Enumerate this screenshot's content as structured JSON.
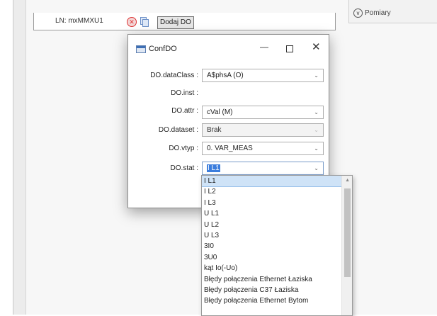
{
  "background": {
    "ln_label": "LN: mxMMXU1",
    "add_button": "Dodaj DO",
    "pomiary_label": "Pomiary"
  },
  "dialog": {
    "title": "ConfDO",
    "fields": {
      "dataClass": {
        "label": "DO.dataClass :",
        "value": "A$phsA (O)"
      },
      "inst": {
        "label": "DO.inst :"
      },
      "attr": {
        "label": "DO.attr :",
        "value": "cVal (M)"
      },
      "dataset": {
        "label": "DO.dataset :",
        "value": "Brak"
      },
      "vtyp": {
        "label": "DO.vtyp :",
        "value": "0. VAR_MEAS"
      },
      "stat": {
        "label": "DO.stat :",
        "value": "I L1"
      }
    },
    "stat_options": [
      "I L1",
      "I L2",
      "I L3",
      "U L1",
      "U L2",
      "U L3",
      "3I0",
      "3U0",
      "kąt Io(-Uo)",
      "Błędy połączenia Ethernet Łaziska",
      "Błędy połączenia C37 Łaziska",
      "Błędy połączenia Ethernet Bytom"
    ],
    "selected_option_index": 0
  },
  "colors": {
    "selection_highlight": "#3b7ddd",
    "list_selected_bg": "#cfe3f7"
  }
}
